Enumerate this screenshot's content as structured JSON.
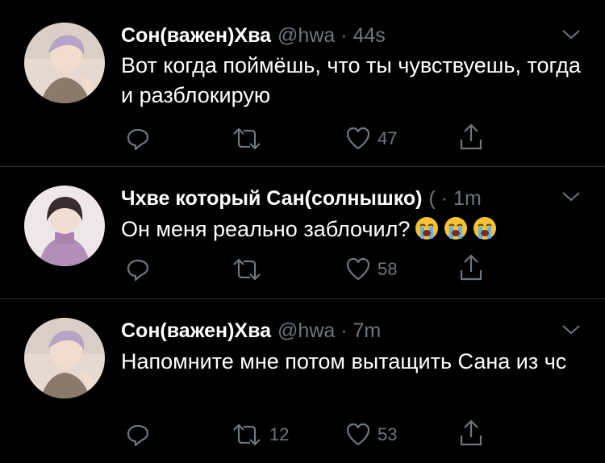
{
  "tweets": [
    {
      "name": "Сон(важен)Хва",
      "meta": "@hwa · 44s",
      "text": "Вот когда поймёшь, что ты чувствуешь, тогда и разблокирую",
      "emoji_count": 0,
      "retweets": "",
      "likes": "47"
    },
    {
      "name": "Чхве который Сан(солнышко)",
      "meta": "( · 1m",
      "text": "Он меня реально заблочил?",
      "emoji_count": 3,
      "emoji_name": "loudly-crying-face",
      "retweets": "",
      "likes": "58"
    },
    {
      "name": "Сон(важен)Хва",
      "meta": "@hwa · 7m",
      "text": "Напомните мне потом вытащить Сана из чс",
      "emoji_count": 0,
      "retweets": "12",
      "likes": "53"
    }
  ],
  "colors": {
    "background": "#000000",
    "secondary": "#6e767d",
    "divider": "#2f3336"
  }
}
